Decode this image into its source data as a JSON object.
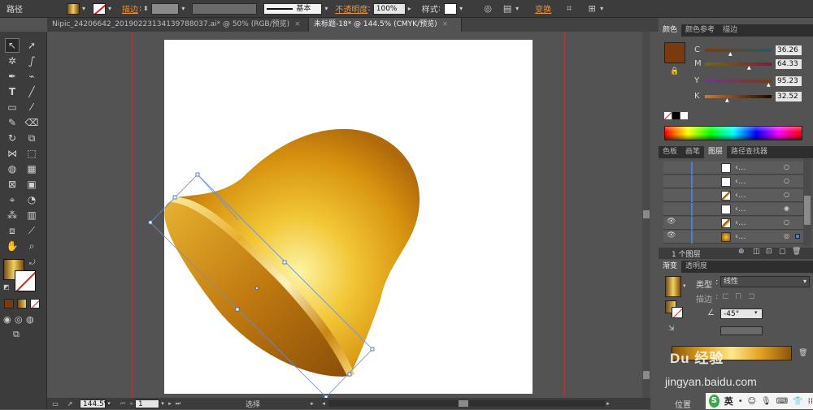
{
  "control_bar": {
    "mode_label": "路径",
    "stroke_label": "描边",
    "stroke_style": "基本",
    "opacity_label": "不透明度",
    "opacity_value": "100%",
    "style_label": "样式",
    "transform_label": "变换"
  },
  "tabs": [
    {
      "label": "Nipic_24206642_20190223134139788037.ai* @ 50% (RGB/预览)",
      "close": "×"
    },
    {
      "label": "未标题-18* @ 144.5% (CMYK/预览)",
      "close": "×"
    }
  ],
  "status": {
    "zoom": "144.5%",
    "page": "1",
    "tool": "选择"
  },
  "color_panel": {
    "tabs": [
      "颜色",
      "颜色参考",
      "描边"
    ],
    "swatch_color": "#7a3a0f",
    "channels": [
      {
        "label": "C",
        "value": "36.26",
        "pos": 0.36,
        "gradient": "linear-gradient(90deg,#7a3a0f,#2a5a5f)"
      },
      {
        "label": "M",
        "value": "64.33",
        "pos": 0.64,
        "gradient": "linear-gradient(90deg,#6d6a16,#7b1d3a)"
      },
      {
        "label": "Y",
        "value": "95.23",
        "pos": 0.95,
        "gradient": "linear-gradient(90deg,#6b3a8a,#7a3a0f)"
      },
      {
        "label": "K",
        "value": "32.52",
        "pos": 0.32,
        "gradient": "linear-gradient(90deg,#c67a3a,#1a0a00)"
      }
    ]
  },
  "layers_panel": {
    "tabs": [
      "色板",
      "画笔",
      "图层",
      "路径查找器"
    ],
    "footer": "1 个图层"
  },
  "gradient_panel": {
    "tabs": [
      "渐变",
      "透明度"
    ],
    "type_label": "类型",
    "type_value": "线性",
    "stroke_label": "描边",
    "angle_value": "-45°",
    "location_label": "位置"
  },
  "watermark": {
    "logo_text": "Du 经验",
    "url": "jingyan.baidu.com"
  },
  "tray": {
    "ime": "英"
  }
}
